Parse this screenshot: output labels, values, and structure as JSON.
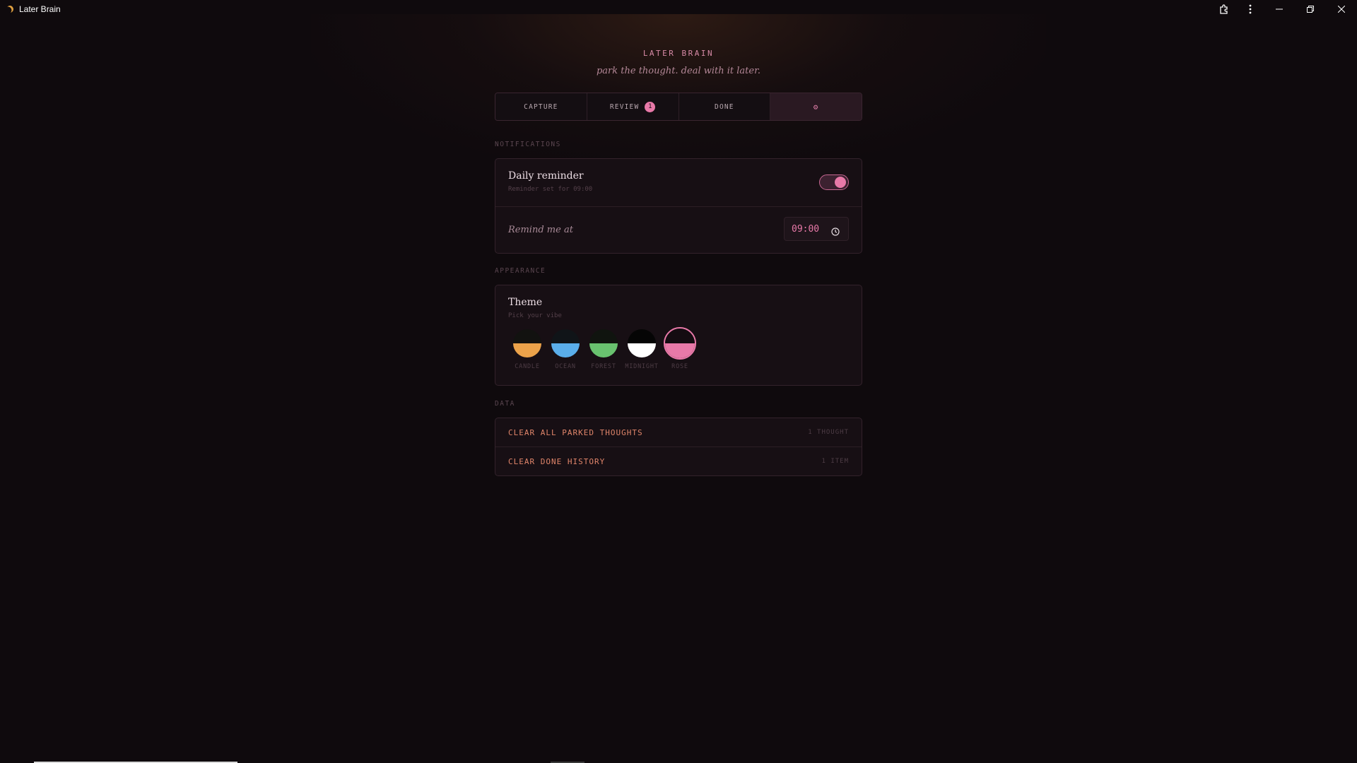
{
  "window": {
    "title": "Later Brain",
    "controls": {
      "extensions_icon": "extensions-icon",
      "more_icon": "more-vertical-icon",
      "minimize": "minimize-icon",
      "restore": "restore-icon",
      "close": "close-icon"
    }
  },
  "app": {
    "brand": "LATER BRAIN",
    "tagline": "park the thought. deal with it later."
  },
  "tabs": [
    {
      "label": "CAPTURE",
      "active": false
    },
    {
      "label": "REVIEW",
      "badge": "1",
      "active": false
    },
    {
      "label": "DONE",
      "active": false
    },
    {
      "label": "⚙",
      "icon": "gear-icon",
      "active": true
    }
  ],
  "notifications": {
    "section_label": "NOTIFICATIONS",
    "daily_reminder": {
      "title": "Daily reminder",
      "subtitle": "Reminder set for 09:00",
      "enabled": true
    },
    "remind_at": {
      "label": "Remind me at",
      "value": "09:00"
    }
  },
  "appearance": {
    "section_label": "APPEARANCE",
    "theme_title": "Theme",
    "theme_subtitle": "Pick your vibe",
    "themes": [
      {
        "name": "CANDLE",
        "top": "#121210",
        "bottom": "#eba24a",
        "selected": false
      },
      {
        "name": "OCEAN",
        "top": "#101418",
        "bottom": "#5aaeea",
        "selected": false
      },
      {
        "name": "FOREST",
        "top": "#10140f",
        "bottom": "#69c26f",
        "selected": false
      },
      {
        "name": "MIDNIGHT",
        "top": "#050505",
        "bottom": "#ffffff",
        "selected": false
      },
      {
        "name": "ROSE",
        "top": "#140c11",
        "bottom": "#e879a8",
        "selected": true
      }
    ]
  },
  "data_section": {
    "section_label": "DATA",
    "rows": [
      {
        "label": "CLEAR ALL PARKED THOUGHTS",
        "count": "1 THOUGHT"
      },
      {
        "label": "CLEAR DONE HISTORY",
        "count": "1 ITEM"
      }
    ]
  },
  "colors": {
    "accent": "#e879a8",
    "danger": "#e0856a",
    "background": "#0f0a0d"
  }
}
